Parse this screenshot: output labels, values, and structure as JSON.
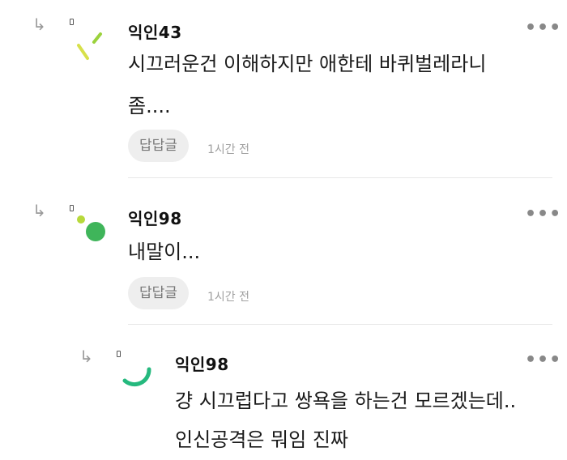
{
  "comments": [
    {
      "nickname": "익인43",
      "lines": [
        "시끄러운건 이해하지만 애한테 바퀴벌레라니",
        "좀...."
      ],
      "reply_label": "답답글",
      "time": "1시간 전",
      "more": "•••"
    },
    {
      "nickname": "익인98",
      "lines": [
        "내말이..."
      ],
      "reply_label": "답답글",
      "time": "1시간 전",
      "more": "•••"
    },
    {
      "nickname": "익인98",
      "lines": [
        "걍 시끄럽다고 쌍욕을 하는건 모르겠는데..",
        "인신공격은 뭐임 진짜"
      ],
      "more": "•••"
    }
  ],
  "icons": {
    "reply_arrow": "reply-arrow-icon",
    "more": "more-dots-icon"
  },
  "colors": {
    "avatar1_yellow": "#d7e04a",
    "avatar1_green": "#9bd23c",
    "avatar2_green": "#3fb55a",
    "avatar2_lime": "#b7d93b",
    "avatar3_teal": "#25b97e"
  }
}
